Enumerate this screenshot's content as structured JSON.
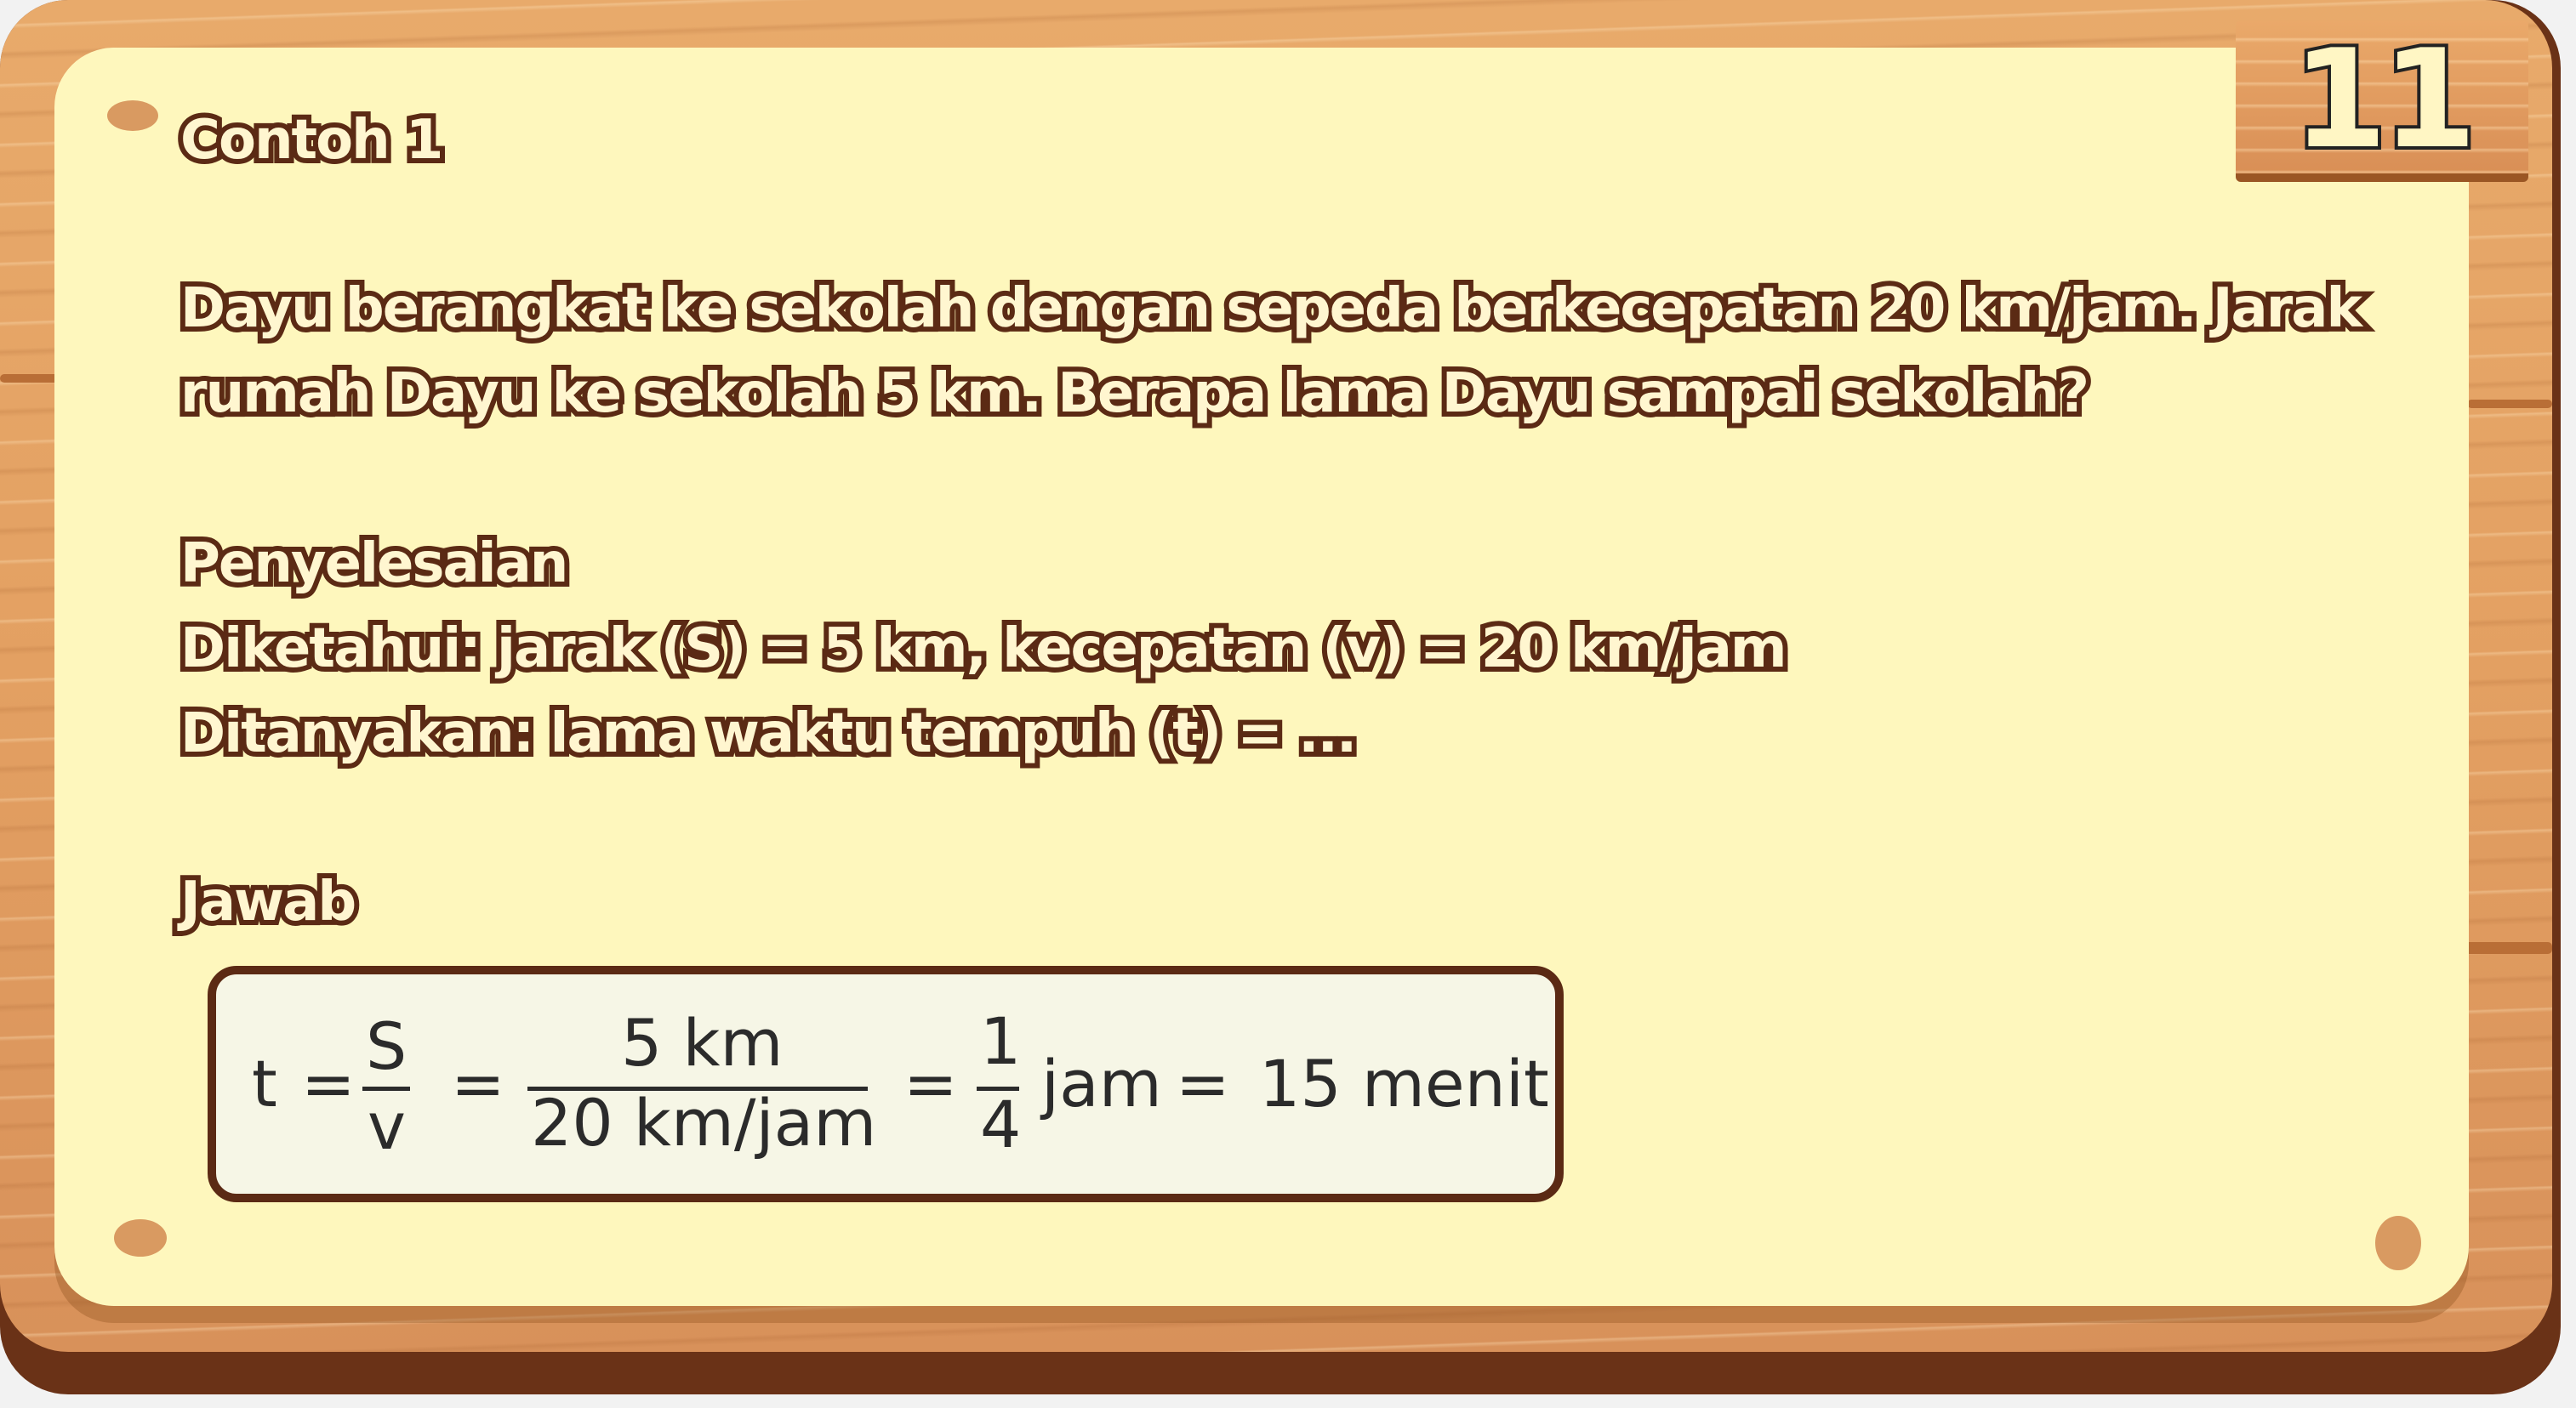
{
  "page_number": "11",
  "title": "Contoh 1",
  "problem": {
    "line1": "Dayu berangkat ke sekolah dengan sepeda berkecepatan 20 km/jam. Jarak",
    "line2": "rumah Dayu ke sekolah 5 km. Berapa lama Dayu sampai sekolah?"
  },
  "solution": {
    "heading": "Penyelesaian",
    "known": "Diketahui: jarak (S) = 5 km, kecepatan (v) = 20 km/jam",
    "asked": "Ditanyakan: lama waktu tempuh (t) = ..."
  },
  "answer": {
    "heading": "Jawab",
    "formula": {
      "lhs": "t",
      "eq1": "=",
      "frac1_num": "S",
      "frac1_den": "v",
      "eq2": "=",
      "frac2_num": "5 km",
      "frac2_den": "20 km/jam",
      "eq3": "=",
      "frac3_num": "1",
      "frac3_den": "4",
      "unit": "jam",
      "eq4": "=",
      "result": "15 menit"
    }
  },
  "colors": {
    "wood": "#e3a062",
    "wood_dark": "#6a3217",
    "paper": "#fef7bd",
    "text_fill": "#fff6d0",
    "text_outline": "#5b2a14"
  }
}
